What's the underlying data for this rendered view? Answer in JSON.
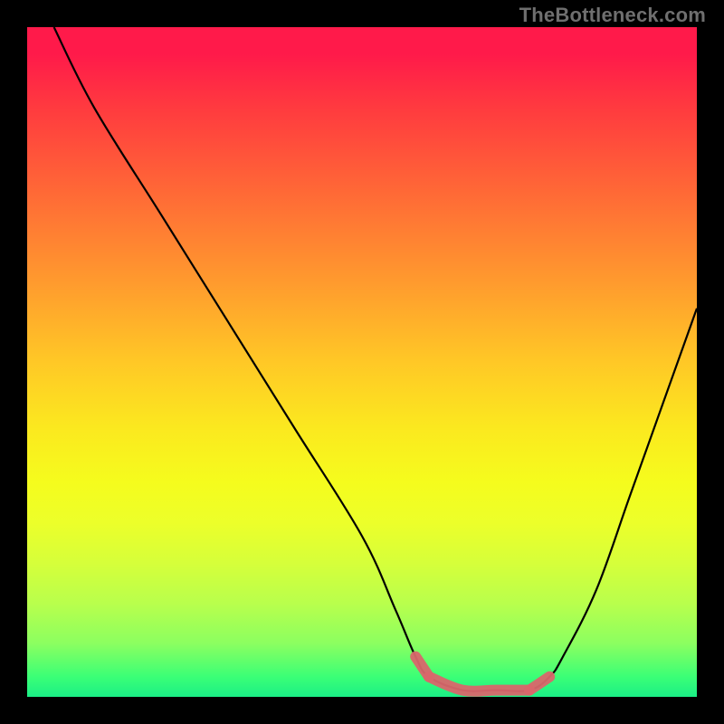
{
  "watermark": "TheBottleneck.com",
  "chart_data": {
    "type": "line",
    "title": "",
    "xlabel": "",
    "ylabel": "",
    "xlim": [
      0,
      100
    ],
    "ylim": [
      0,
      100
    ],
    "grid": false,
    "series": [
      {
        "name": "bottleneck-curve",
        "color": "#000000",
        "x": [
          4,
          10,
          20,
          30,
          40,
          50,
          55,
          58,
          60,
          65,
          70,
          75,
          78,
          80,
          85,
          90,
          95,
          100
        ],
        "y": [
          100,
          88,
          72,
          56,
          40,
          24,
          13,
          6,
          3,
          1,
          1,
          1,
          3,
          6,
          16,
          30,
          44,
          58
        ]
      },
      {
        "name": "optimal-range-left",
        "color": "#d9666b",
        "x": [
          58,
          60
        ],
        "y": [
          6,
          3
        ]
      },
      {
        "name": "optimal-range-flat",
        "color": "#d9666b",
        "x": [
          60,
          65,
          70,
          75
        ],
        "y": [
          3,
          1,
          1,
          1
        ]
      },
      {
        "name": "optimal-range-right",
        "color": "#d9666b",
        "x": [
          75,
          78
        ],
        "y": [
          1,
          3
        ]
      }
    ],
    "annotations": [],
    "background_gradient": {
      "top": "#ff1a4a",
      "mid": "#fbe91f",
      "bottom": "#1bef86"
    }
  }
}
